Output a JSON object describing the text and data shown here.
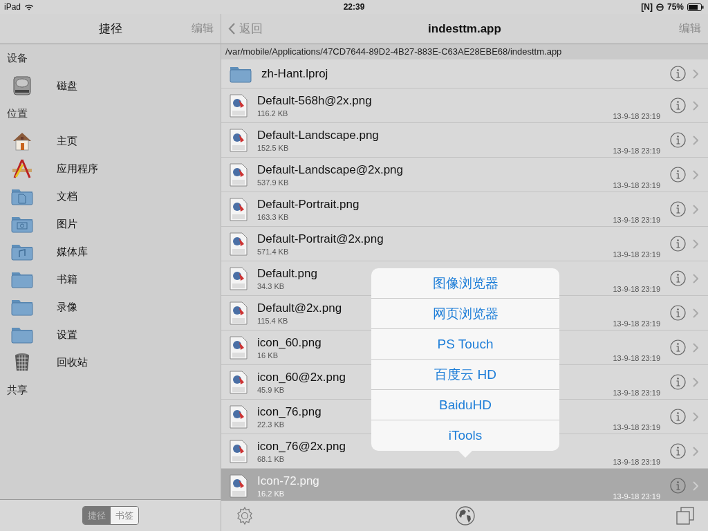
{
  "status_bar": {
    "device": "iPad",
    "time": "22:39",
    "indicator": "[N]",
    "battery": "75%"
  },
  "sidebar": {
    "title": "捷径",
    "edit": "编辑",
    "sections": [
      {
        "title": "设备",
        "items": [
          {
            "label": "磁盘",
            "kind": "disk"
          }
        ]
      },
      {
        "title": "位置",
        "items": [
          {
            "label": "主页",
            "kind": "home"
          },
          {
            "label": "应用程序",
            "kind": "apps"
          },
          {
            "label": "文档",
            "kind": "docs"
          },
          {
            "label": "图片",
            "kind": "pictures"
          },
          {
            "label": "媒体库",
            "kind": "music"
          },
          {
            "label": "书籍",
            "kind": "folder"
          },
          {
            "label": "录像",
            "kind": "folder"
          },
          {
            "label": "设置",
            "kind": "folder"
          },
          {
            "label": "回收站",
            "kind": "trash"
          }
        ]
      },
      {
        "title": "共享"
      }
    ],
    "segments": [
      {
        "label": "捷径",
        "selected": true
      },
      {
        "label": "书签",
        "selected": false
      }
    ]
  },
  "browser": {
    "back": "返回",
    "title": "indesttm.app",
    "edit": "编辑",
    "path": "/var/mobile/Applications/47CD7644-89D2-4B27-883E-C63AE28EBE68/indesttm.app",
    "files": [
      {
        "name": "zh-Hant.lproj",
        "kind": "folder",
        "selected": false
      },
      {
        "name": "Default-568h@2x.png",
        "size": "116.2 KB",
        "date": "13-9-18 23:19",
        "kind": "png",
        "selected": false
      },
      {
        "name": "Default-Landscape.png",
        "size": "152.5 KB",
        "date": "13-9-18 23:19",
        "kind": "png",
        "selected": false
      },
      {
        "name": "Default-Landscape@2x.png",
        "size": "537.9 KB",
        "date": "13-9-18 23:19",
        "kind": "png",
        "selected": false
      },
      {
        "name": "Default-Portrait.png",
        "size": "163.3 KB",
        "date": "13-9-18 23:19",
        "kind": "png",
        "selected": false
      },
      {
        "name": "Default-Portrait@2x.png",
        "size": "571.4 KB",
        "date": "13-9-18 23:19",
        "kind": "png",
        "selected": false
      },
      {
        "name": "Default.png",
        "size": "34.3 KB",
        "date": "13-9-18 23:19",
        "kind": "png",
        "selected": false
      },
      {
        "name": "Default@2x.png",
        "size": "115.4 KB",
        "date": "13-9-18 23:19",
        "kind": "png",
        "selected": false
      },
      {
        "name": "icon_60.png",
        "size": "16 KB",
        "date": "13-9-18 23:19",
        "kind": "png",
        "selected": false
      },
      {
        "name": "icon_60@2x.png",
        "size": "45.9 KB",
        "date": "13-9-18 23:19",
        "kind": "png",
        "selected": false
      },
      {
        "name": "icon_76.png",
        "size": "22.3 KB",
        "date": "13-9-18 23:19",
        "kind": "png",
        "selected": false
      },
      {
        "name": "icon_76@2x.png",
        "size": "68.1 KB",
        "date": "13-9-18 23:19",
        "kind": "png",
        "selected": false
      },
      {
        "name": "Icon-72.png",
        "size": "16.2 KB",
        "date": "13-9-18 23:19",
        "kind": "png",
        "selected": true
      }
    ]
  },
  "open_with_menu": [
    "图像浏览器",
    "网页浏览器",
    "PS Touch",
    "百度云 HD",
    "BaiduHD",
    "iTools"
  ]
}
